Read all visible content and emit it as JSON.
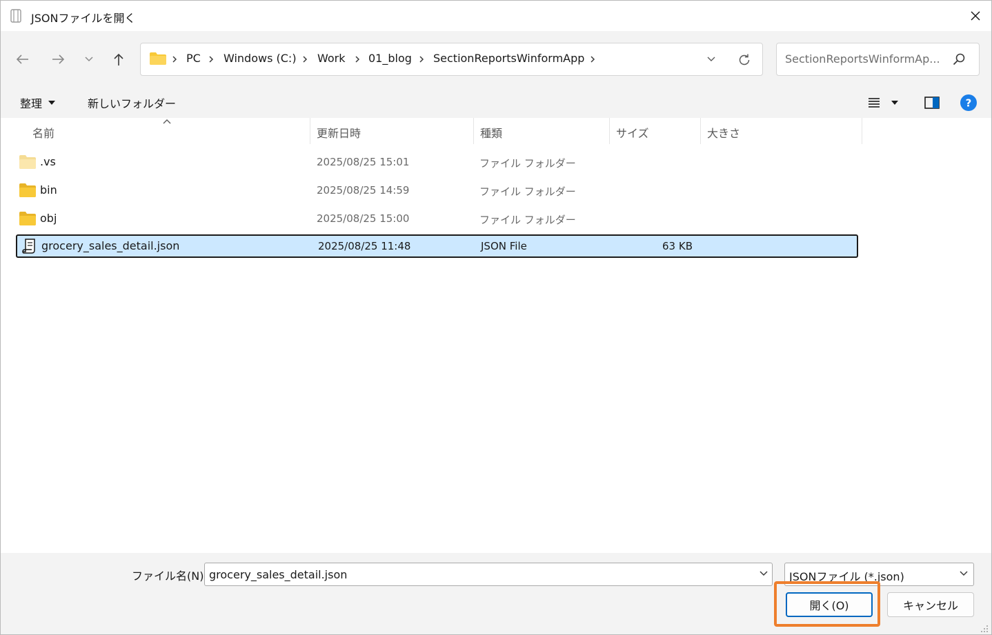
{
  "window": {
    "title": "JSONファイルを開く",
    "close_glyph": "✕"
  },
  "nav": {
    "back_glyph": "←",
    "forward_glyph": "→",
    "recent_glyph": "⌄",
    "up_glyph": "↑",
    "breadcrumb": [
      "PC",
      "Windows (C:)",
      "Work",
      "01_blog",
      "SectionReportsWinformApp"
    ],
    "separator_glyph": "›",
    "search_placeholder": "SectionReportsWinformAp..."
  },
  "toolbar": {
    "organize_label": "整理",
    "new_folder_label": "新しいフォルダー"
  },
  "columns": {
    "name": "名前",
    "date": "更新日時",
    "type": "種類",
    "size": "サイズ",
    "dimension": "大きさ"
  },
  "files": [
    {
      "name": ".vs",
      "date": "2025/08/25 15:01",
      "type": "ファイル フォルダー",
      "size": "",
      "kind": "folder-light"
    },
    {
      "name": "bin",
      "date": "2025/08/25 14:59",
      "type": "ファイル フォルダー",
      "size": "",
      "kind": "folder"
    },
    {
      "name": "obj",
      "date": "2025/08/25 15:00",
      "type": "ファイル フォルダー",
      "size": "",
      "kind": "folder"
    },
    {
      "name": "grocery_sales_detail.json",
      "date": "2025/08/25 11:48",
      "type": "JSON File",
      "size": "63 KB",
      "kind": "json-file",
      "selected": true
    }
  ],
  "footer": {
    "filename_label": "ファイル名(N):",
    "filename_value": "grocery_sales_detail.json",
    "filetype_value": "JSONファイル (*.json)",
    "open_label": "開く(O)",
    "cancel_label": "キャンセル"
  },
  "colors": {
    "selection": "#cce8ff",
    "accent": "#0067c0",
    "highlight": "#ee7f2d",
    "folder": "#f8c938"
  }
}
